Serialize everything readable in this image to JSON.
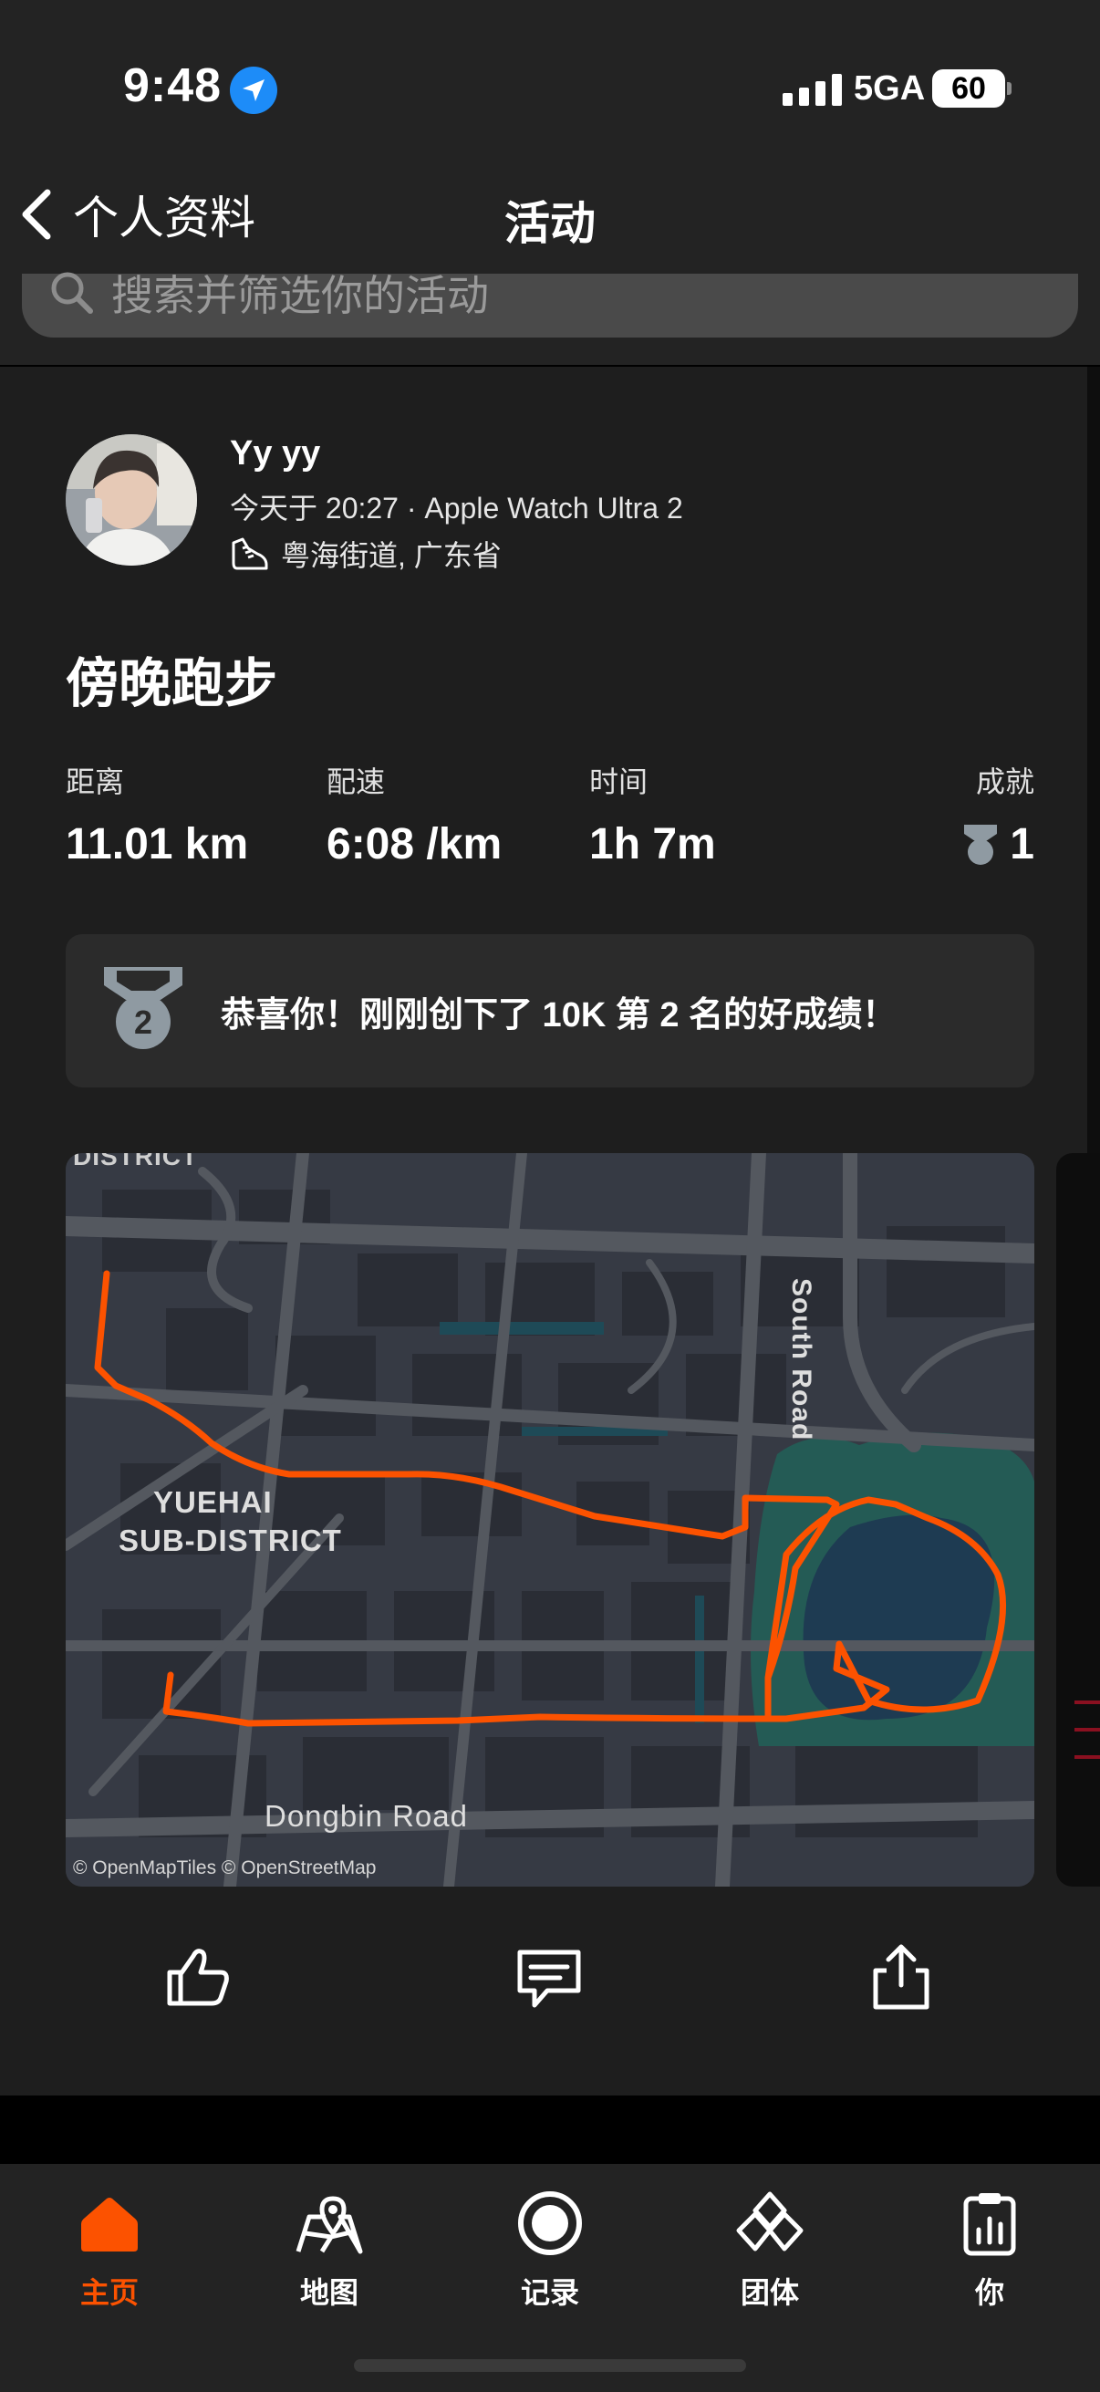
{
  "status_bar": {
    "time": "9:48",
    "network": "5GA",
    "battery": "60"
  },
  "nav": {
    "back_label": "个人资料",
    "title": "活动"
  },
  "search": {
    "placeholder": "搜索并筛选你的活动"
  },
  "activity": {
    "athlete_name": "Yy yy",
    "meta": "今天于 20:27 · Apple Watch Ultra 2",
    "location": "粤海街道, 广东省",
    "title": "傍晚跑步",
    "stats": [
      {
        "label": "距离",
        "value": "11.01 km"
      },
      {
        "label": "配速",
        "value": "6:08 /km"
      },
      {
        "label": "时间",
        "value": "1h 7m"
      }
    ],
    "achievements": {
      "label": "成就",
      "value": "1"
    },
    "banner": {
      "medal_rank": "2",
      "text": "恭喜你！刚刚创下了 10K 第 2 名的好成绩！"
    },
    "map": {
      "labels": {
        "district_top": "DISTRICT",
        "south_road": "South Road",
        "yuehai": "YUEHAI",
        "subdistrict": "SUB-DISTRICT",
        "dongbin": "Dongbin Road"
      },
      "attribution": "© OpenMapTiles © OpenStreetMap",
      "route_color": "#fc5200"
    },
    "actions": {
      "like_icon": "thumbs-up-icon",
      "comment_icon": "comment-icon",
      "share_icon": "share-icon"
    }
  },
  "tab_bar": {
    "active_color": "#fc5200",
    "tabs": [
      {
        "label": "主页",
        "icon": "home-icon",
        "active": true
      },
      {
        "label": "地图",
        "icon": "map-icon",
        "active": false
      },
      {
        "label": "记录",
        "icon": "record-icon",
        "active": false
      },
      {
        "label": "团体",
        "icon": "groups-icon",
        "active": false
      },
      {
        "label": "你",
        "icon": "profile-icon",
        "active": false
      }
    ]
  }
}
